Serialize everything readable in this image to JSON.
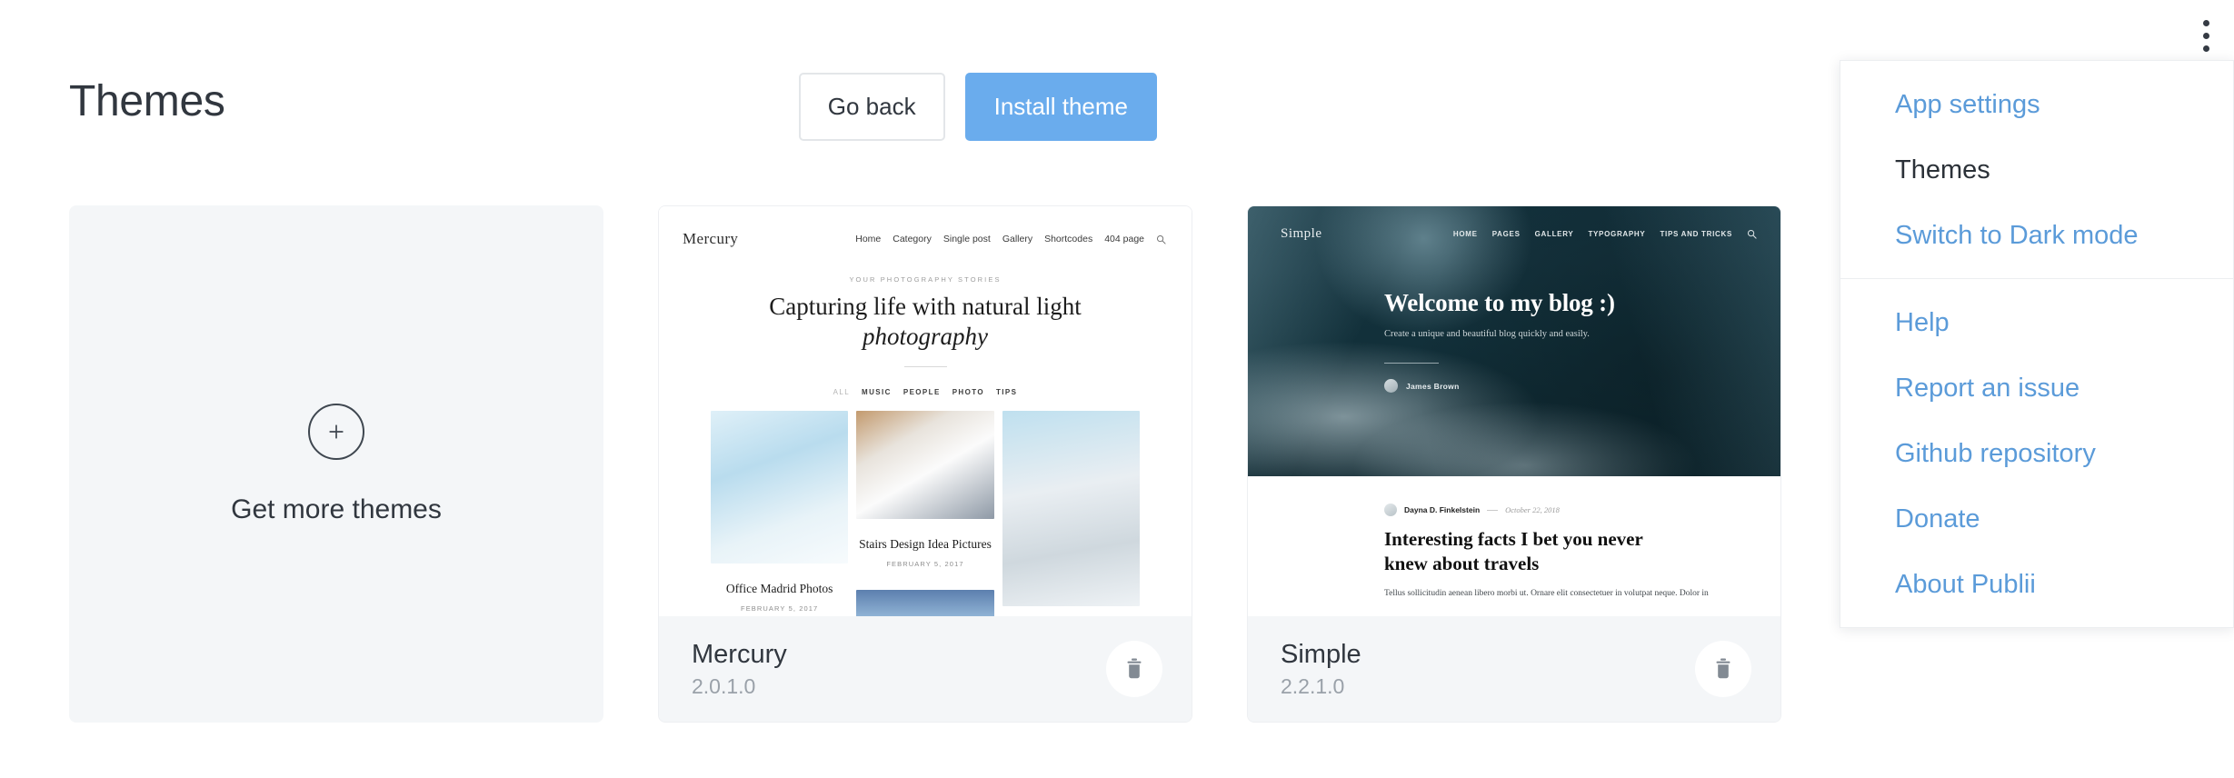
{
  "header": {
    "title": "Themes",
    "go_back_label": "Go back",
    "install_theme_label": "Install theme"
  },
  "kebab_menu_icon": "more-vertical-icon",
  "add_card": {
    "icon": "plus-circle-icon",
    "label": "Get more themes"
  },
  "dropdown": {
    "groups": [
      {
        "items": [
          {
            "label": "App settings",
            "current": false
          },
          {
            "label": "Themes",
            "current": true
          },
          {
            "label": "Switch to Dark mode",
            "current": false
          }
        ]
      },
      {
        "items": [
          {
            "label": "Help",
            "current": false
          },
          {
            "label": "Report an issue",
            "current": false
          },
          {
            "label": "Github repository",
            "current": false
          },
          {
            "label": "Donate",
            "current": false
          },
          {
            "label": "About Publii",
            "current": false
          }
        ]
      }
    ]
  },
  "themes": [
    {
      "name": "Mercury",
      "version": "2.0.1.0",
      "delete_icon": "trash-icon",
      "preview": {
        "logo": "Mercury",
        "nav": [
          "Home",
          "Category",
          "Single post",
          "Gallery",
          "Shortcodes",
          "404 page"
        ],
        "search_icon": "search-icon",
        "kicker": "YOUR PHOTOGRAPHY STORIES",
        "heading_line1": "Capturing life with natural light",
        "heading_line2": "photography",
        "categories": [
          "ALL",
          "MUSIC",
          "PEOPLE",
          "PHOTO",
          "TIPS"
        ],
        "posts": [
          {
            "title": "Office Madrid Photos",
            "date": "FEBRUARY 5, 2017"
          },
          {
            "title": "Stairs Design Idea Pictures",
            "date": "FEBRUARY 5, 2017"
          }
        ]
      }
    },
    {
      "name": "Simple",
      "version": "2.2.1.0",
      "delete_icon": "trash-icon",
      "preview": {
        "logo": "Simple",
        "nav": [
          "HOME",
          "PAGES",
          "GALLERY",
          "TYPOGRAPHY",
          "TIPS AND TRICKS"
        ],
        "search_icon": "search-icon",
        "hero_title": "Welcome to my blog :)",
        "hero_subtitle": "Create a unique and beautiful blog quickly and easily.",
        "hero_author": "James Brown",
        "article": {
          "author": "Dayna D. Finkelstein",
          "date": "October 22, 2018",
          "title": "Interesting facts I bet you never knew about travels",
          "excerpt": "Tellus sollicitudin aenean libero morbi ut. Ornare elit consectetuer in volutpat neque. Dolor in"
        }
      }
    }
  ],
  "colors": {
    "accent": "#6aaced",
    "link": "#5b9bd9",
    "text": "#31373f",
    "card_bg": "#f4f6f8"
  }
}
